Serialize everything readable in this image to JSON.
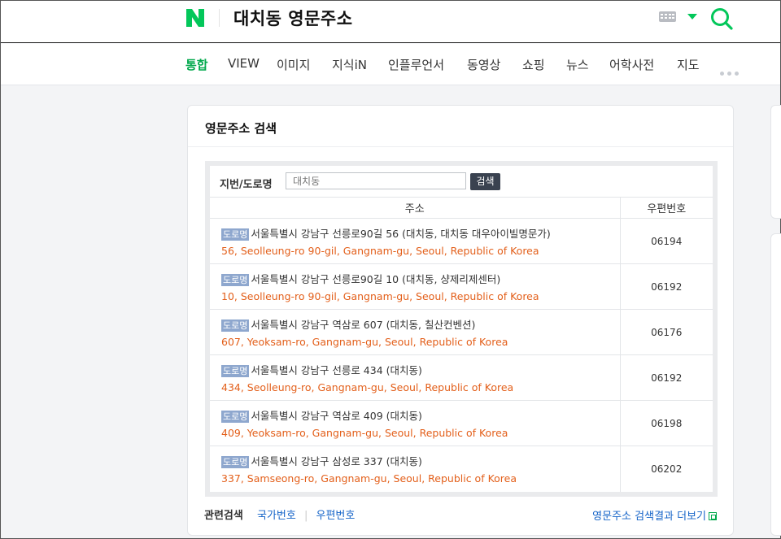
{
  "header": {
    "logo_icon": "naver-n-logo-icon",
    "query": "대치동 영문주소",
    "keyboard_icon": "keyboard-icon",
    "dropdown_icon": "caret-down-icon",
    "search_icon": "search-icon",
    "brand_color": "#03c75a"
  },
  "tabs": [
    {
      "label": "통합",
      "active": true
    },
    {
      "label": "VIEW"
    },
    {
      "label": "이미지"
    },
    {
      "label": "지식iN"
    },
    {
      "label": "인플루언서"
    },
    {
      "label": "동영상"
    },
    {
      "label": "쇼핑"
    },
    {
      "label": "뉴스"
    },
    {
      "label": "어학사전"
    },
    {
      "label": "지도"
    }
  ],
  "card": {
    "title": "영문주소 검색",
    "search_label": "지번/도로명",
    "search_placeholder": "대치동",
    "search_button": "검색",
    "col_address": "주소",
    "col_zip": "우편번호",
    "rows": [
      {
        "badge": "도로명",
        "korean": "서울특별시 강남구 선릉로90길 56 (대치동, 대치동 대우아이빌명문가)",
        "english": "56, Seolleung-ro 90-gil, Gangnam-gu, Seoul, Republic of Korea",
        "zip": "06194"
      },
      {
        "badge": "도로명",
        "korean": "서울특별시 강남구 선릉로90길 10 (대치동, 샹제리제센터)",
        "english": "10, Seolleung-ro 90-gil, Gangnam-gu, Seoul, Republic of Korea",
        "zip": "06192"
      },
      {
        "badge": "도로명",
        "korean": "서울특별시 강남구 역삼로 607 (대치동, 칠산컨벤션)",
        "english": "607, Yeoksam-ro, Gangnam-gu, Seoul, Republic of Korea",
        "zip": "06176"
      },
      {
        "badge": "도로명",
        "korean": "서울특별시 강남구 선릉로 434 (대치동)",
        "english": "434, Seolleung-ro, Gangnam-gu, Seoul, Republic of Korea",
        "zip": "06192"
      },
      {
        "badge": "도로명",
        "korean": "서울특별시 강남구 역삼로 409 (대치동)",
        "english": "409, Yeoksam-ro, Gangnam-gu, Seoul, Republic of Korea",
        "zip": "06198"
      },
      {
        "badge": "도로명",
        "korean": "서울특별시 강남구 삼성로 337 (대치동)",
        "english": "337, Samseong-ro, Gangnam-gu, Seoul, Republic of Korea",
        "zip": "06202"
      }
    ],
    "related_label": "관련검색",
    "related_links": [
      "국가번호",
      "우편번호"
    ],
    "more_link": "영문주소 검색결과 더보기",
    "more_icon": "external-link-icon"
  }
}
